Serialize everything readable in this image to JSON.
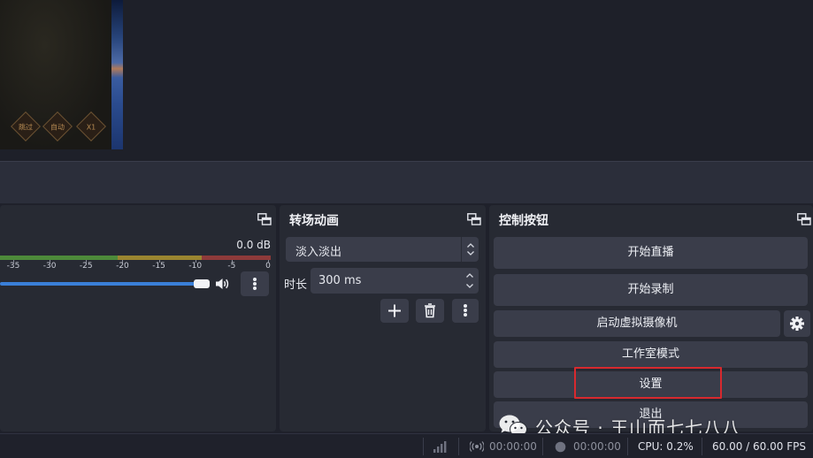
{
  "preview": {
    "game_buttons": [
      "跳过",
      "自动",
      "X1"
    ]
  },
  "mixer": {
    "db_value": "0.0 dB",
    "ticks": [
      "-35",
      "-30",
      "-25",
      "-20",
      "-15",
      "-10",
      "-5",
      "0"
    ],
    "volume_level": 0.96
  },
  "transitions": {
    "title": "转场动画",
    "selected": "淡入淡出",
    "duration_label": "时长",
    "duration_value": "300 ms"
  },
  "controls": {
    "title": "控制按钮",
    "buttons": [
      "开始直播",
      "开始录制",
      "启动虚拟摄像机",
      "工作室模式",
      "设置",
      "退出"
    ]
  },
  "watermark": {
    "text": "公众号 · 王山而七七八八"
  },
  "status": {
    "stream_time": "00:00:00",
    "record_time": "00:00:00",
    "cpu": "CPU: 0.2%",
    "fps": "60.00 / 60.00 FPS"
  },
  "colors": {
    "accent": "#3a7fd8",
    "highlight": "#d8292e"
  }
}
